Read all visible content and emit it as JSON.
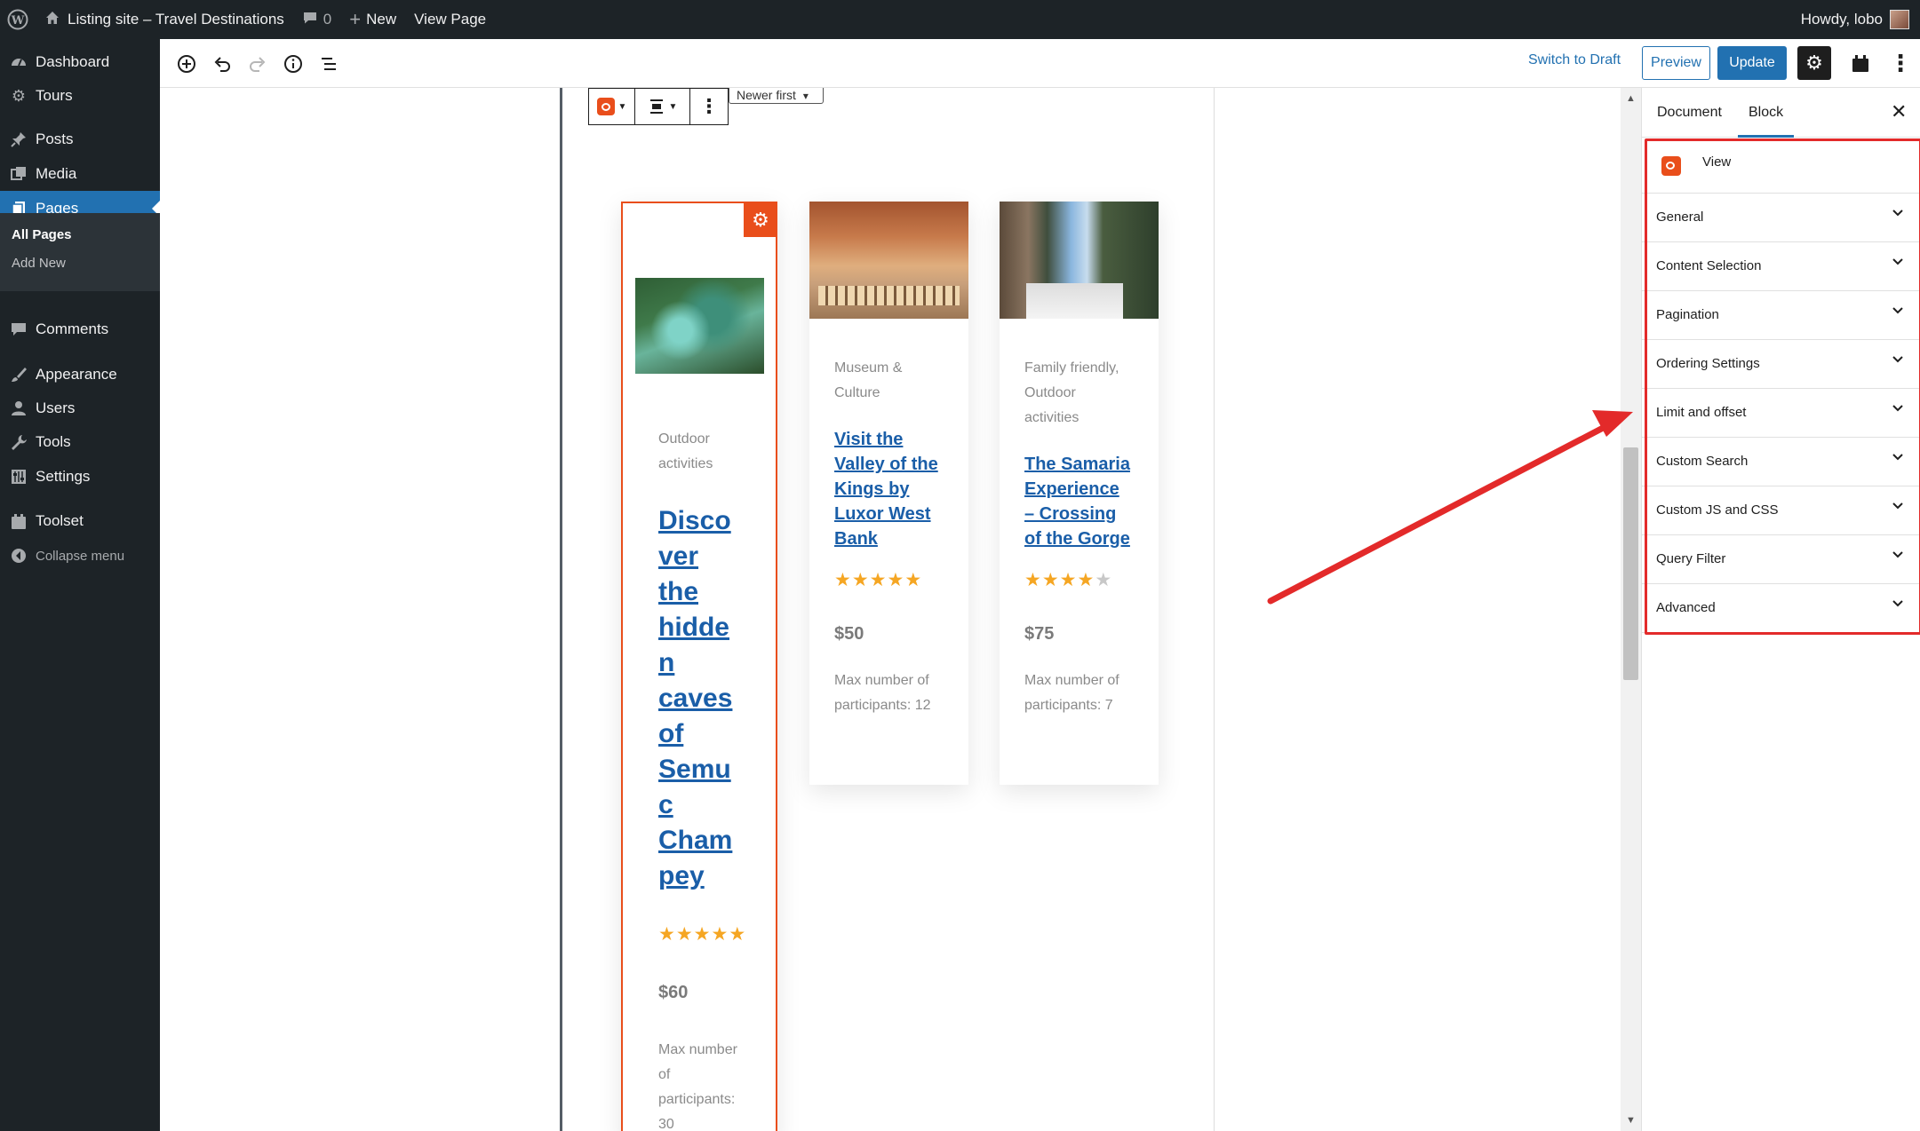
{
  "colors": {
    "admin_bg": "#1d2327",
    "accent": "#2271b1",
    "brand_orange": "#e94e1b",
    "annotation_red": "#e32a2a",
    "title_blue": "#1a5ea8",
    "star_gold": "#f5a623"
  },
  "adminbar": {
    "wp_icon": "wordpress-logo-icon",
    "site_name": "Listing site – Travel Destinations",
    "comments_count": "0",
    "new_label": "New",
    "view_page_label": "View Page",
    "howdy": "Howdy, lobo"
  },
  "adminmenu": {
    "items": [
      {
        "label": "Dashboard",
        "icon": "dashboard-icon"
      },
      {
        "label": "Tours",
        "icon": "gear-icon"
      },
      {
        "label": "Posts",
        "icon": "pushpin-icon"
      },
      {
        "label": "Media",
        "icon": "media-icon"
      },
      {
        "label": "Pages",
        "icon": "pages-icon"
      },
      {
        "label": "Comments",
        "icon": "comment-icon"
      },
      {
        "label": "Appearance",
        "icon": "paintbrush-icon"
      },
      {
        "label": "Users",
        "icon": "user-icon"
      },
      {
        "label": "Tools",
        "icon": "wrench-icon"
      },
      {
        "label": "Settings",
        "icon": "settings-sliders-icon"
      },
      {
        "label": "Toolset",
        "icon": "toolset-icon"
      }
    ],
    "submenu": [
      "All Pages",
      "Add New"
    ],
    "collapse": "Collapse menu"
  },
  "toolbar": {
    "switch_to_draft": "Switch to Draft",
    "preview": "Preview",
    "update": "Update"
  },
  "canvas": {
    "sort_value": "Newer first",
    "cards": [
      {
        "category": [
          "Outdoor",
          "activities"
        ],
        "title": [
          "Disco",
          "ver",
          "the",
          "hidde",
          "n",
          "caves",
          "of",
          "Semu",
          "c",
          "Cham",
          "pey"
        ],
        "rating": 5,
        "price": "$60",
        "max_participants": [
          "Max number",
          "of",
          "participants:",
          "30"
        ]
      },
      {
        "category": [
          "Museum &",
          "Culture"
        ],
        "title": [
          "Visit the",
          "Valley of the",
          "Kings by",
          "Luxor West",
          "Bank"
        ],
        "rating": 5,
        "price": "$50",
        "max_participants": [
          "Max number of",
          "participants: 12"
        ]
      },
      {
        "category": [
          "Family friendly,",
          "Outdoor",
          "activities"
        ],
        "title": [
          "The Samaria",
          "Experience",
          "– Crossing",
          "of the Gorge"
        ],
        "rating": 4,
        "price": "$75",
        "max_participants": [
          "Max number of",
          "participants: 7"
        ]
      }
    ]
  },
  "sidebar": {
    "tabs": [
      "Document",
      "Block"
    ],
    "active_tab": "Block",
    "block_name": "View",
    "panels": [
      "General",
      "Content Selection",
      "Pagination",
      "Ordering Settings",
      "Limit and offset",
      "Custom Search",
      "Custom JS and CSS",
      "Query Filter",
      "Advanced"
    ]
  }
}
